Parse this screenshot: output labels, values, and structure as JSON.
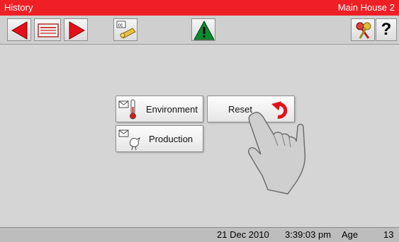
{
  "titlebar": {
    "title": "History",
    "location": "Main House 2"
  },
  "toolbar": {
    "buttons": [
      {
        "name": "back-arrow-icon"
      },
      {
        "name": "calendar-icon"
      },
      {
        "name": "forward-arrow-icon"
      },
      {
        "name": "cc-key-icon"
      },
      {
        "name": "alarm-warning-icon"
      },
      {
        "name": "access-keys-icon"
      },
      {
        "name": "help-icon"
      }
    ],
    "help_label": "?"
  },
  "menu": {
    "environment_label": "Environment",
    "reset_label": "Reset",
    "production_label": "Production"
  },
  "status": {
    "date": "21 Dec 2010",
    "time": "3:39:03 pm",
    "age_label": "Age",
    "age_value": "13"
  },
  "colors": {
    "title_bar": "#ee2026",
    "arrow_red": "#e3101c",
    "warning_green": "#0b8c2f"
  }
}
